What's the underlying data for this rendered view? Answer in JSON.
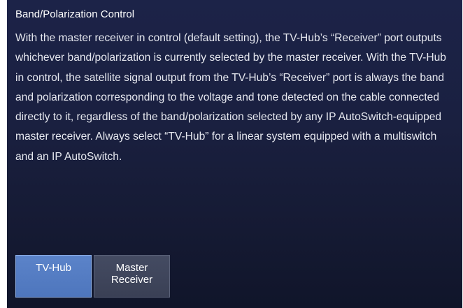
{
  "panel": {
    "title": "Band/Polarization Control",
    "description": "With the master receiver in control (default setting), the TV-Hub’s “Receiver” port outputs whichever band/polarization is currently selected by the master receiver. With the TV-Hub in control, the satellite signal output from the TV-Hub’s “Receiver” port is always the band and polarization corresponding to the voltage and tone detected on the cable connected directly to it, regardless of the band/polarization selected by any IP AutoSwitch-equipped master receiver. Always select “TV-Hub” for a linear system equipped with a multiswitch and an IP AutoSwitch."
  },
  "controls": {
    "options": [
      {
        "label": "TV-Hub",
        "selected": true
      },
      {
        "label": "Master\nReceiver",
        "selected": false
      }
    ]
  },
  "colors": {
    "active_button": "#5279c2",
    "inactive_button": "#3f4559",
    "panel_background": "#1a2040"
  }
}
